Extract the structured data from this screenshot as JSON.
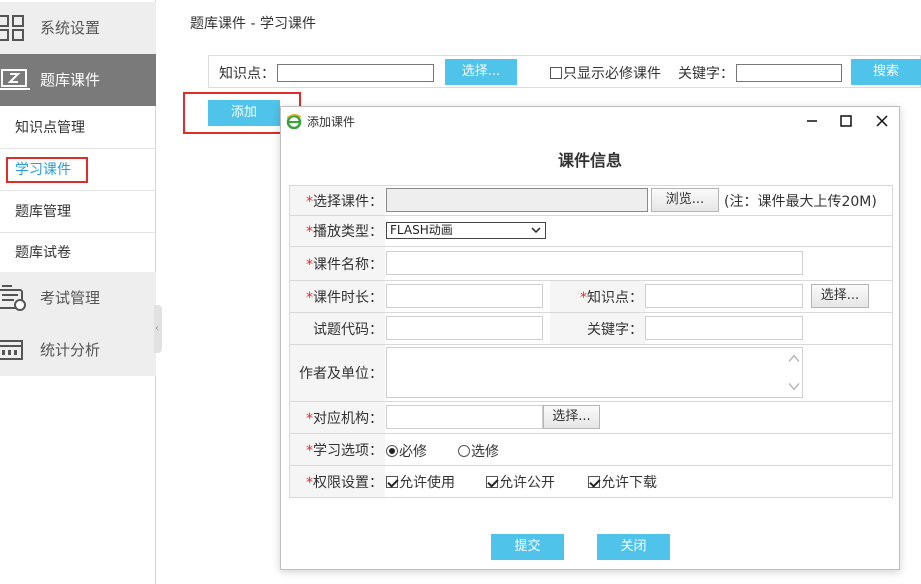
{
  "sidebar": {
    "sections": [
      {
        "label": "系统设置",
        "icon": "grid-icon"
      },
      {
        "label": "题库课件",
        "icon": "courseware-icon"
      },
      {
        "label": "考试管理",
        "icon": "exam-icon"
      },
      {
        "label": "统计分析",
        "icon": "chart-panel-icon"
      }
    ],
    "sub_items": [
      "知识点管理",
      "学习课件",
      "题库管理",
      "题库试卷"
    ],
    "active_sub_item": "学习课件"
  },
  "breadcrumb": "题库课件 - 学习课件",
  "filter": {
    "knowledge_label": "知识点：",
    "knowledge_value": "",
    "select_btn": "选择...",
    "required_only_label": "只显示必修课件",
    "required_only_checked": false,
    "keyword_label": "关键字：",
    "keyword_value": "",
    "search_btn": "搜索"
  },
  "add_btn": "添加",
  "dialog": {
    "window_title": "添加课件",
    "heading": "课件信息",
    "required_mark": "*",
    "fields": {
      "file_label": "选择课件：",
      "browse_btn": "浏览...",
      "file_note": "(注：课件最大上传20M)",
      "play_type_label": "播放类型：",
      "play_type_value": "FLASH动画",
      "name_label": "课件名称：",
      "duration_label": "课件时长：",
      "knowledge_label": "知识点：",
      "knowledge_btn": "选择...",
      "question_code_label": "试题代码：",
      "keyword_label": "关键字：",
      "author_label": "作者及单位：",
      "org_label": "对应机构：",
      "org_btn": "选择...",
      "study_option_label": "学习选项：",
      "study_options": [
        "必修",
        "选修"
      ],
      "study_option_selected": "必修",
      "permission_label": "权限设置：",
      "permissions": [
        {
          "label": "允许使用",
          "checked": true
        },
        {
          "label": "允许公开",
          "checked": true
        },
        {
          "label": "允许下载",
          "checked": true
        }
      ]
    },
    "submit_btn": "提交",
    "close_btn": "关闭"
  },
  "colors": {
    "accent_blue": "#4fc3e9",
    "active_link": "#2a9fd6",
    "highlight_red": "#e02b2b",
    "sidebar_active_bg": "#7a7a7a"
  }
}
